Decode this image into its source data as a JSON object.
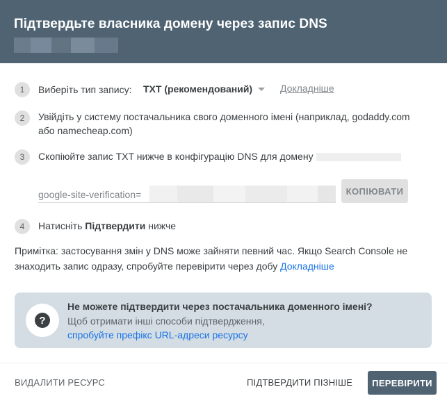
{
  "header": {
    "title": "Підтвердьте власника домену через запис DNS"
  },
  "colors": {
    "header_bg": "#4f6373",
    "link": "#1a73e8",
    "help_card_bg": "#d3dde3",
    "primary_button": "#4f6373"
  },
  "steps": [
    {
      "number": "1",
      "text": "Виберіть тип запису:"
    },
    {
      "number": "2",
      "text": "Увійдіть у систему постачальника свого доменного імені (наприклад, godaddy.com або namecheap.com)"
    },
    {
      "number": "3",
      "text": "Скопіюйте запис TXT нижче в конфігурацію DNS для домену"
    },
    {
      "number": "4",
      "text_before": "Натисніть ",
      "text_bold": "Підтвердити",
      "text_after": " нижче"
    }
  ],
  "record_type": {
    "selected": "TXT (рекомендований)",
    "learn_more": "Докладніше"
  },
  "txt_record": {
    "prefix": "google-site-verification=",
    "copy_label": "КОПІЮВАТИ"
  },
  "note": {
    "text": "Примітка: застосування змін у DNS може зайняти певний час. Якщо Search Console не знаходить запис одразу, спробуйте перевірити через добу ",
    "link": "Докладніше"
  },
  "help_card": {
    "icon": "help-icon",
    "title": "Не можете підтвердити через постачальника доменного імені?",
    "subtitle": "Щоб отримати інші способи підтвердження,",
    "link": "спробуйте префікс URL-адреси ресурсу"
  },
  "footer": {
    "delete_label": "ВИДАЛИТИ РЕСУРС",
    "later_label": "ПІДТВЕРДИТИ ПІЗНІШЕ",
    "verify_label": "ПЕРЕВІРИТИ"
  }
}
